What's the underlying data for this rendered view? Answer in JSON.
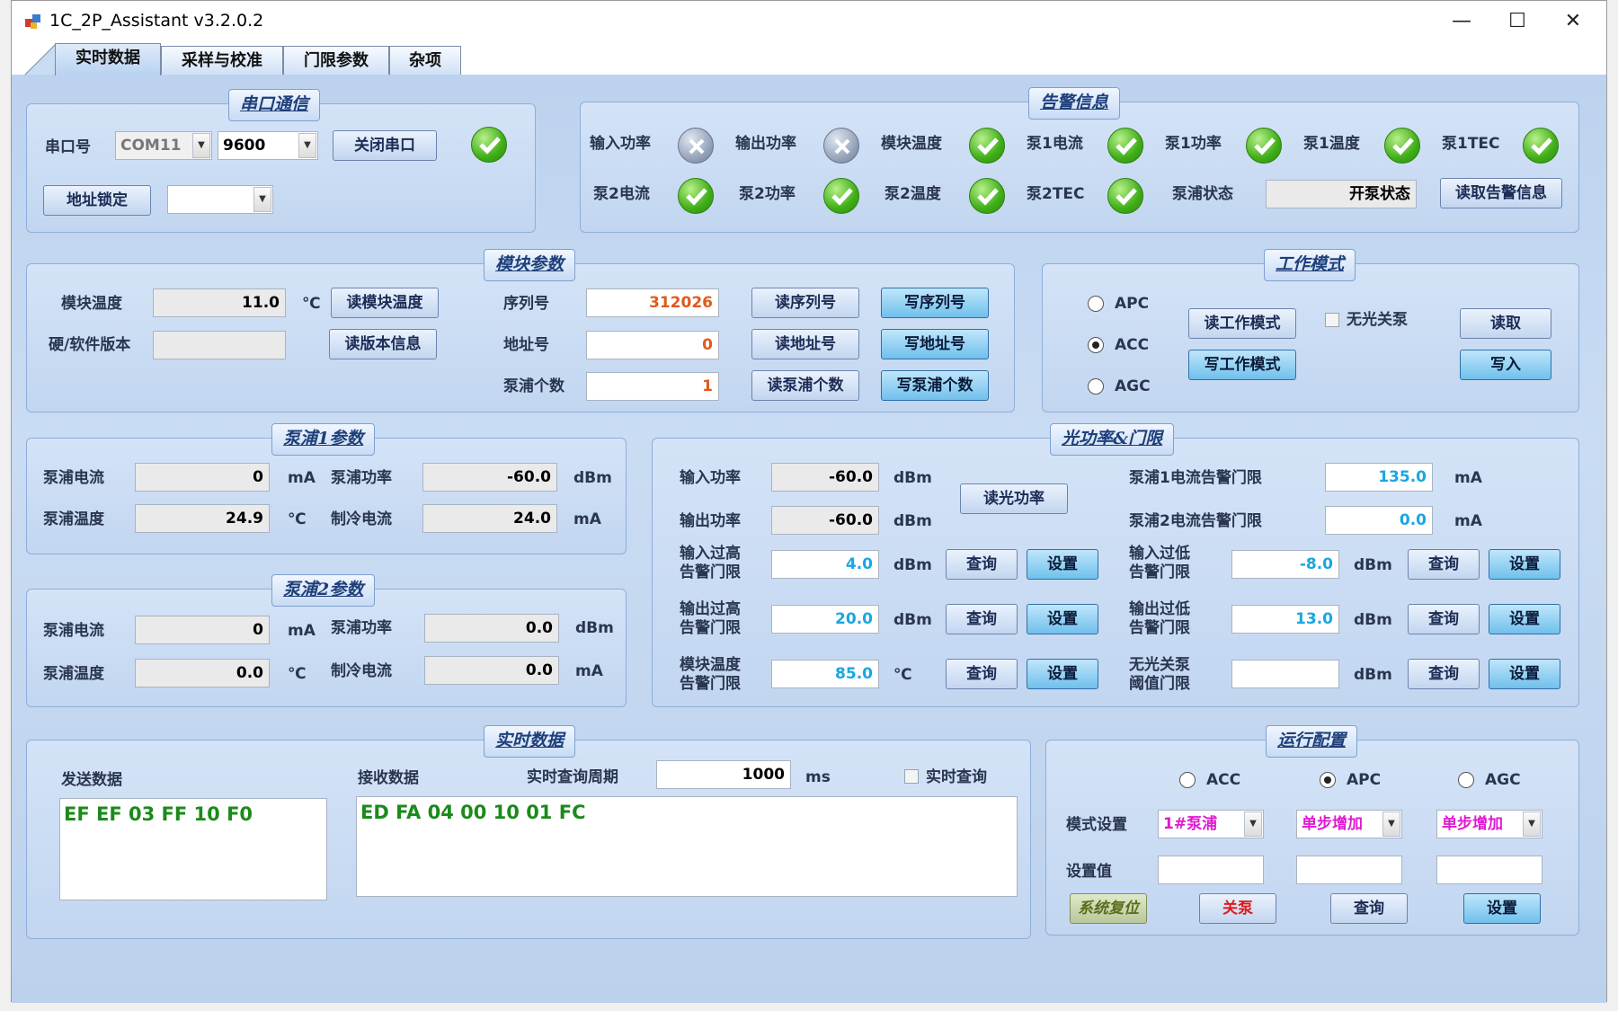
{
  "window": {
    "title": "1C_2P_Assistant v3.2.0.2",
    "minimize": "—",
    "maximize": "☐",
    "close": "✕"
  },
  "tabs": [
    "实时数据",
    "采样与校准",
    "门限参数",
    "杂项"
  ],
  "serial": {
    "title": "串口通信",
    "port_label": "串口号",
    "port_value": "COM11",
    "baud_value": "9600",
    "close_btn": "关闭串口",
    "addr_lock_btn": "地址锁定",
    "addr_value": ""
  },
  "alarm": {
    "title": "告警信息",
    "items": [
      {
        "label": "输入功率",
        "status": "fail"
      },
      {
        "label": "输出功率",
        "status": "fail"
      },
      {
        "label": "模块温度",
        "status": "ok"
      },
      {
        "label": "泵1电流",
        "status": "ok"
      },
      {
        "label": "泵1功率",
        "status": "ok"
      },
      {
        "label": "泵1温度",
        "status": "ok"
      },
      {
        "label": "泵1TEC",
        "status": "ok"
      },
      {
        "label": "泵2电流",
        "status": "ok"
      },
      {
        "label": "泵2功率",
        "status": "ok"
      },
      {
        "label": "泵2温度",
        "status": "ok"
      },
      {
        "label": "泵2TEC",
        "status": "ok"
      }
    ],
    "pump_state_label": "泵浦状态",
    "pump_state_value": "开泵状态",
    "read_btn": "读取告警信息"
  },
  "module": {
    "title": "模块参数",
    "temp_label": "模块温度",
    "temp_value": "11.0",
    "temp_unit": "℃",
    "read_temp_btn": "读模块温度",
    "version_label": "硬/软件版本",
    "version_value": "",
    "read_version_btn": "读版本信息",
    "serial_label": "序列号",
    "serial_value": "312026",
    "read_serial_btn": "读序列号",
    "write_serial_btn": "写序列号",
    "addr_label": "地址号",
    "addr_value": "0",
    "read_addr_btn": "读地址号",
    "write_addr_btn": "写地址号",
    "pumps_label": "泵浦个数",
    "pumps_value": "1",
    "read_pumps_btn": "读泵浦个数",
    "write_pumps_btn": "写泵浦个数"
  },
  "workmode": {
    "title": "工作模式",
    "apc": "APC",
    "acc": "ACC",
    "agc": "AGC",
    "selected": "ACC",
    "read_btn": "读工作模式",
    "write_btn": "写工作模式",
    "no_light_label": "无光关泵",
    "read2": "读取",
    "write2": "写入"
  },
  "pump1": {
    "title": "泵浦1参数",
    "current_label": "泵浦电流",
    "current_value": "0",
    "current_unit": "mA",
    "power_label": "泵浦功率",
    "power_value": "-60.0",
    "power_unit": "dBm",
    "temp_label": "泵浦温度",
    "temp_value": "24.9",
    "temp_unit": "℃",
    "cool_label": "制冷电流",
    "cool_value": "24.0",
    "cool_unit": "mA"
  },
  "pump2": {
    "title": "泵浦2参数",
    "current_label": "泵浦电流",
    "current_value": "0",
    "current_unit": "mA",
    "power_label": "泵浦功率",
    "power_value": "0.0",
    "power_unit": "dBm",
    "temp_label": "泵浦温度",
    "temp_value": "0.0",
    "temp_unit": "℃",
    "cool_label": "制冷电流",
    "cool_value": "0.0",
    "cool_unit": "mA"
  },
  "optical": {
    "title": "光功率&门限",
    "in_power_label": "输入功率",
    "in_power_value": "-60.0",
    "out_power_label": "输出功率",
    "out_power_value": "-60.0",
    "dbm": "dBm",
    "ma": "mA",
    "degc": "℃",
    "read_power_btn": "读光功率",
    "in_high_l1": "输入过高",
    "in_high_l2": "告警门限",
    "in_high_value": "4.0",
    "out_high_l1": "输出过高",
    "out_high_l2": "告警门限",
    "out_high_value": "20.0",
    "mod_temp_l1": "模块温度",
    "mod_temp_l2": "告警门限",
    "mod_temp_value": "85.0",
    "p1_cur_label": "泵浦1电流告警门限",
    "p1_cur_value": "135.0",
    "p2_cur_label": "泵浦2电流告警门限",
    "p2_cur_value": "0.0",
    "in_low_l1": "输入过低",
    "in_low_l2": "告警门限",
    "in_low_value": "-8.0",
    "out_low_l1": "输出过低",
    "out_low_l2": "告警门限",
    "out_low_value": "13.0",
    "nolight_l1": "无光关泵",
    "nolight_l2": "阈值门限",
    "nolight_value": "",
    "query": "查询",
    "set": "设置"
  },
  "realtime": {
    "title": "实时数据",
    "send_label": "发送数据",
    "recv_label": "接收数据",
    "period_label": "实时查询周期",
    "period_value": "1000",
    "period_unit": "ms",
    "realtime_chk": "实时查询",
    "send_data": "EF EF 03 FF 10 F0",
    "recv_data": "ED FA 04 00 10 01 FC"
  },
  "runcfg": {
    "title": "运行配置",
    "acc": "ACC",
    "apc": "APC",
    "agc": "AGC",
    "selected": "APC",
    "mode_label": "模式设置",
    "combo1": "1#泵浦",
    "combo2": "单步增加",
    "combo3": "单步增加",
    "set_value_label": "设置值",
    "reset_btn": "系统复位",
    "off_btn": "关泵",
    "query_btn": "查询",
    "set_btn": "设置"
  }
}
